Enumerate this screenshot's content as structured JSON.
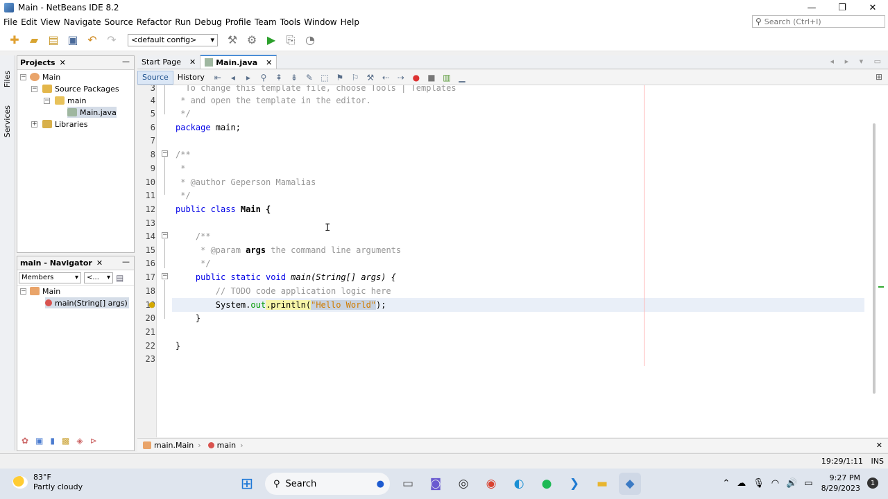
{
  "window": {
    "title": "Main - NetBeans IDE 8.2",
    "min": "—",
    "max": "❐",
    "close": "✕"
  },
  "menu": [
    "File",
    "Edit",
    "View",
    "Navigate",
    "Source",
    "Refactor",
    "Run",
    "Debug",
    "Profile",
    "Team",
    "Tools",
    "Window",
    "Help"
  ],
  "search": {
    "placeholder": "Search (Ctrl+I)"
  },
  "toolbar": {
    "config": "<default config>"
  },
  "sidestrip": {
    "files": "Files",
    "services": "Services"
  },
  "projects": {
    "title": "Projects",
    "tree": {
      "root": "Main",
      "source_packages": "Source Packages",
      "package": "main",
      "file": "Main.java",
      "libraries": "Libraries"
    }
  },
  "navigator": {
    "title": "main - Navigator",
    "filter": "Members",
    "filter2": "<...",
    "tree": {
      "class": "Main",
      "method": "main(String[] args)"
    }
  },
  "editor_tabs": [
    {
      "label": "Start Page",
      "active": false
    },
    {
      "label": "Main.java",
      "active": true
    }
  ],
  "editor_toolbar": {
    "source": "Source",
    "history": "History"
  },
  "code": {
    "l3": "  To change this template file, choose Tools | Templates",
    "l4": " * and open the template in the editor.",
    "l5": " */",
    "l6_kw": "package",
    "l6_rest": " main;",
    "l8": "/**",
    "l9": " *",
    "l10": " * @author Geperson Mamalias",
    "l11": " */",
    "l12_kw": "public class",
    "l12_rest": " Main {",
    "l14": "    /**",
    "l15_a": "     * @param ",
    "l15_b": "args",
    "l15_c": " the command line arguments",
    "l16": "     */",
    "l17_kw": "    public static void ",
    "l17_rest": "main(String[] args) {",
    "l18": "        // TODO code application logic here",
    "l19_a": "        System.",
    "l19_b": "out",
    "l19_c": ".println(",
    "l19_d": "\"Hello World\"",
    "l19_e": ");",
    "l20": "    }",
    "l22": "}"
  },
  "breadcrumb": [
    "main.Main",
    "main"
  ],
  "status": {
    "position": "19:29/1:11",
    "mode": "INS"
  },
  "taskbar": {
    "temp": "83°F",
    "weather": "Partly cloudy",
    "search": "Search",
    "time": "9:27 PM",
    "date": "8/29/2023",
    "notifications": "1"
  }
}
